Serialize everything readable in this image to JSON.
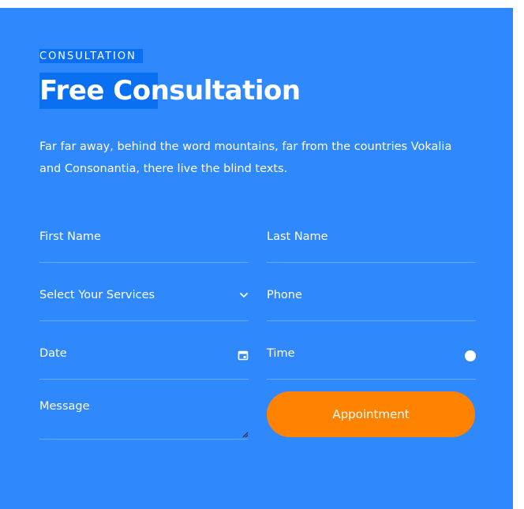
{
  "header": {
    "eyebrow": "CONSULTATION",
    "title": "Free Consultation",
    "description": "Far far away, behind the word mountains, far from the countries Vokalia and Consonantia, there live the blind texts."
  },
  "form": {
    "first_name": "First Name",
    "last_name": "Last Name",
    "services": "Select Your Services",
    "phone": "Phone",
    "date": "Date",
    "time": "Time",
    "message": "Message",
    "submit_label": "Appointment"
  },
  "colors": {
    "panel": "#2f89fc",
    "highlight": "#0a6ff0",
    "button": "#ff8300"
  },
  "icons": [
    "chevron-down-icon",
    "calendar-icon",
    "clock-icon",
    "resize-handle-icon"
  ]
}
